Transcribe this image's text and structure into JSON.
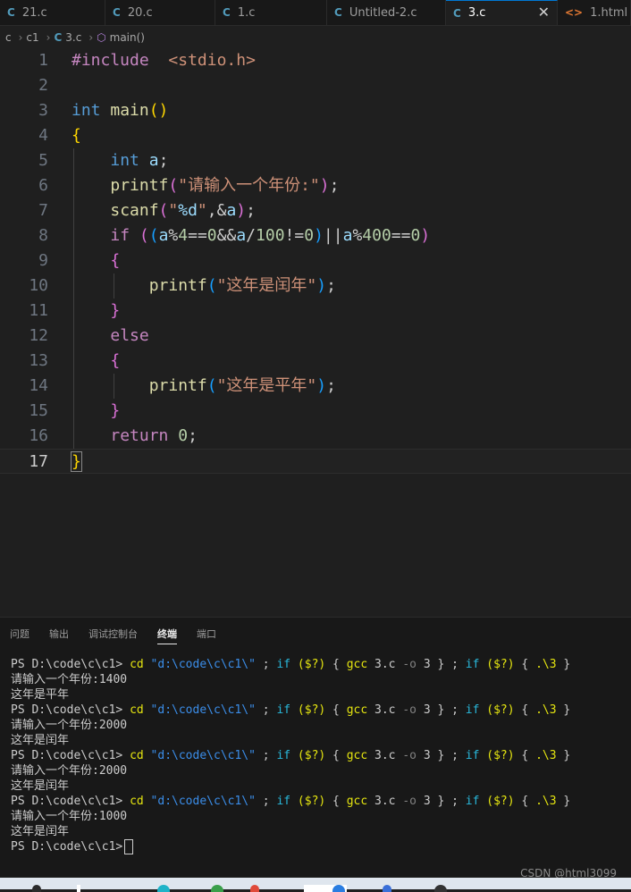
{
  "tabs": [
    {
      "icon": "C",
      "label": "21.c",
      "active": false
    },
    {
      "icon": "C",
      "label": "20.c",
      "active": false
    },
    {
      "icon": "C",
      "label": "1.c",
      "active": false
    },
    {
      "icon": "C",
      "label": "Untitled-2.c",
      "active": false
    },
    {
      "icon": "C",
      "label": "3.c",
      "active": true
    },
    {
      "icon": "<>",
      "label": "1.html",
      "active": false
    }
  ],
  "close_glyph": "✕",
  "breadcrumb": {
    "root": "c",
    "folder": "c1",
    "file_icon": "C",
    "file": "3.c",
    "symbol": "main()"
  },
  "line_numbers": [
    "1",
    "2",
    "3",
    "4",
    "5",
    "6",
    "7",
    "8",
    "9",
    "10",
    "11",
    "12",
    "13",
    "14",
    "15",
    "16",
    "17"
  ],
  "code": {
    "l1_directive": "#include",
    "l1_header": "<stdio.h>",
    "l3_type": "int",
    "l3_name": "main",
    "l6_fn": "printf",
    "l6_str": "\"请输入一个年份:\"",
    "l7_fn": "scanf",
    "l7_str_open": "\"",
    "l7_fmt": "%d",
    "l7_str_close": "\"",
    "l8_kw": "if",
    "l10_fn": "printf",
    "l10_str": "\"这年是闰年\"",
    "l12_kw": "else",
    "l14_fn": "printf",
    "l14_str": "\"这年是平年\"",
    "l16_kw": "return",
    "l16_num": "0"
  },
  "panel_tabs": [
    "问题",
    "输出",
    "调试控制台",
    "终端",
    "端口"
  ],
  "panel_active": "终端",
  "terminal": {
    "prompt": "PS D:\\code\\c\\c1>",
    "cmd_cd": "cd",
    "cmd_path": "\"d:\\code\\c\\c1\\\"",
    "cmd_if": "if",
    "cmd_cond": "($?)",
    "cmd_gcc": "gcc",
    "cmd_src": "3.c",
    "cmd_flag": "-o",
    "cmd_out": "3",
    "cmd_run": ".\\3",
    "input_prompt": "请输入一个年份:",
    "runs": [
      {
        "input": "1400",
        "result": "这年是平年"
      },
      {
        "input": "2000",
        "result": "这年是闰年"
      },
      {
        "input": "2000",
        "result": "这年是闰年"
      },
      {
        "input": "1000",
        "result": "这年是闰年"
      }
    ]
  },
  "watermark": "CSDN @html3099",
  "colors": {
    "accent": "#0078d4",
    "editor_bg": "#1f1f1f",
    "panel_bg": "#181818"
  }
}
